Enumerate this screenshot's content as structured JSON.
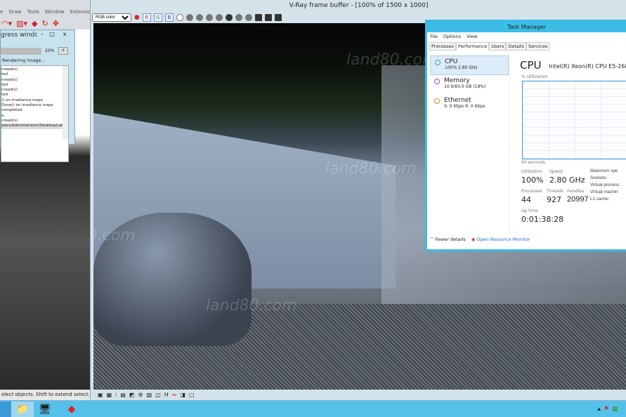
{
  "sketchup": {
    "menu": [
      "e",
      "Draw",
      "Tools",
      "Window",
      "Extensions"
    ],
    "status": "elect objects. Shift to extend select. Drag"
  },
  "progress": {
    "title": "gress window",
    "percent": "20%",
    "cancel": "x",
    "status": "Rendering image...",
    "log": [
      "nread(s)",
      "ted",
      "nread(s)",
      "ted",
      "nread(s)",
      "ted",
      "() on irradiance maps",
      "Done() on irradiance maps",
      "completed.",
      "e.",
      "nread(s)",
      "Jsers/Administrator/Desktop/Lak"
    ]
  },
  "vray": {
    "title": "V-Ray frame buffer - [100% of 1500 x 1000]",
    "channel": "RGB color",
    "channels": [
      "R",
      "G",
      "B"
    ],
    "watermark": "land80.com"
  },
  "taskmanager": {
    "title": "Task Manager",
    "menu": [
      "File",
      "Options",
      "View"
    ],
    "tabs": [
      "Processes",
      "Performance",
      "Users",
      "Details",
      "Services"
    ],
    "active_tab": "Performance",
    "resources": [
      {
        "name": "CPU",
        "sub": "100% 2.80 GHz",
        "color": "#3a9ad9"
      },
      {
        "name": "Memory",
        "sub": "10.6/60.0 GB (18%)",
        "color": "#a23fc4"
      },
      {
        "name": "Ethernet",
        "sub": "S: 0 Kbps R: 0 Kbps",
        "color": "#d98a2a"
      }
    ],
    "cpu": {
      "heading": "CPU",
      "model": "Intel(R) Xeon(R) CPU E5-2680",
      "util_label": "% Utilization",
      "time_label": "60 seconds",
      "utilization_pct": 100,
      "stats": {
        "utilization_label": "Utilization",
        "utilization": "100%",
        "speed_label": "Speed",
        "speed": "2.80 GHz",
        "processes_label": "Processes",
        "processes": "44",
        "threads_label": "Threads",
        "threads": "927",
        "handles_label": "Handles",
        "handles": "20997",
        "uptime_label": "Up time",
        "uptime": "0:01:38:28"
      },
      "right_labels": [
        "Maximum spe",
        "Sockets:",
        "Virtual process",
        "Virtual machin",
        "L1 cache:"
      ]
    },
    "footer": {
      "fewer": "Fewer details",
      "monitor": "Open Resource Monitor"
    }
  }
}
